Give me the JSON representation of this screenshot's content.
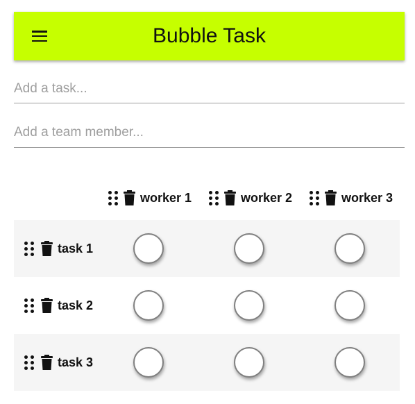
{
  "app": {
    "title": "Bubble Task",
    "accent_color": "#c6ff00",
    "menu_icon": "menu-icon"
  },
  "inputs": {
    "task_placeholder": "Add a task...",
    "task_value": "",
    "member_placeholder": "Add a team member...",
    "member_value": ""
  },
  "icons": {
    "drag": "drag-handle-icon",
    "delete": "trash-icon"
  },
  "workers": [
    {
      "label": "worker 1"
    },
    {
      "label": "worker 2"
    },
    {
      "label": "worker 3"
    }
  ],
  "tasks": [
    {
      "label": "task 1",
      "assignments": [
        false,
        false,
        false
      ]
    },
    {
      "label": "task 2",
      "assignments": [
        false,
        false,
        false
      ]
    },
    {
      "label": "task 3",
      "assignments": [
        false,
        false,
        false
      ]
    }
  ]
}
